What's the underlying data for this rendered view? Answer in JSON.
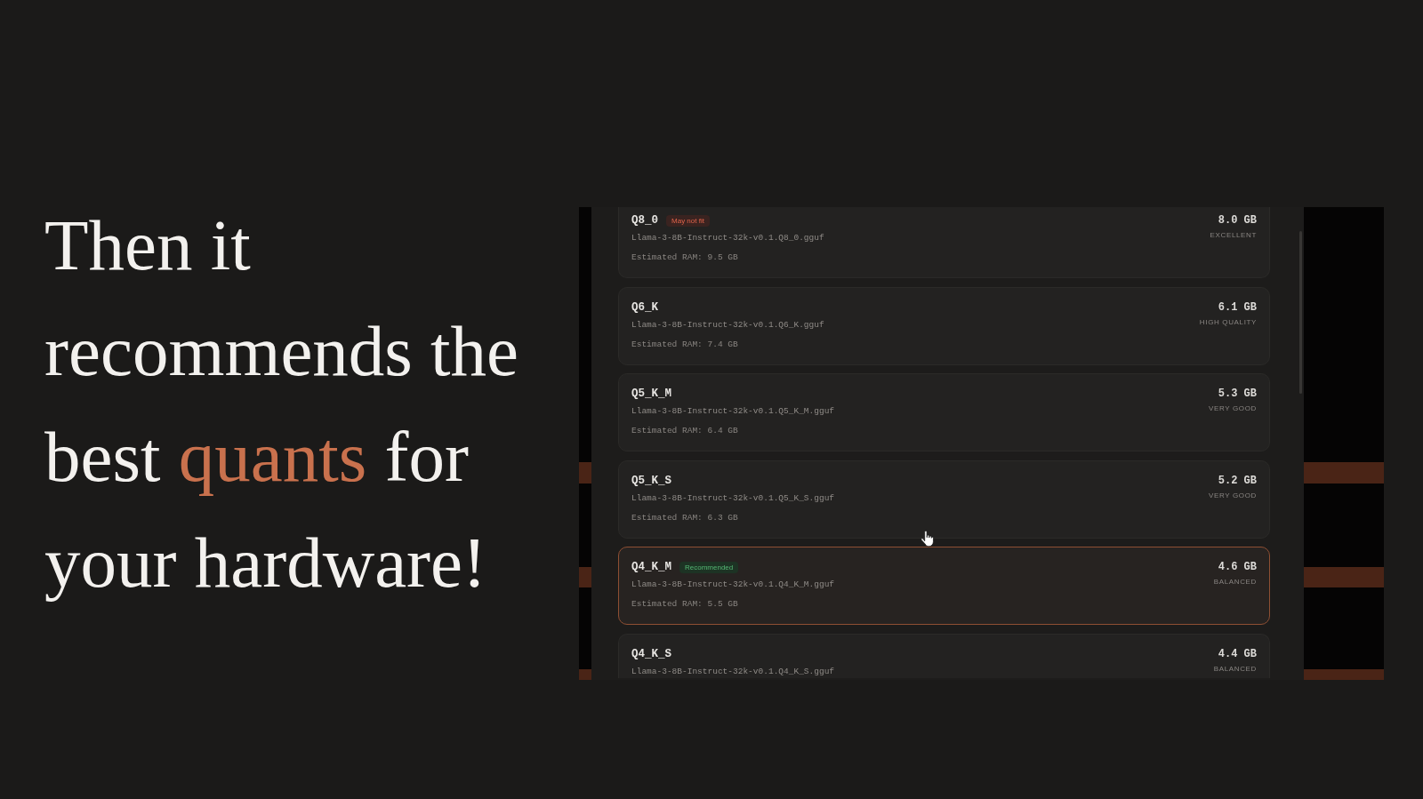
{
  "headline": {
    "lines": [
      [
        {
          "text": "Then it",
          "accent": false
        }
      ],
      [
        {
          "text": "recommends the",
          "accent": false
        }
      ],
      [
        {
          "text": "best ",
          "accent": false
        },
        {
          "text": "quants",
          "accent": true
        },
        {
          "text": " for",
          "accent": false
        }
      ],
      [
        {
          "text": "your hardware!",
          "accent": false
        }
      ]
    ]
  },
  "quant_list": {
    "items": [
      {
        "name": "Q8_0",
        "badge": {
          "kind": "warning",
          "label": "May not fit"
        },
        "file": "Llama-3-8B-Instruct-32k-v0.1.Q8_0.gguf",
        "ram": "Estimated RAM: 9.5 GB",
        "size": "8.0 GB",
        "quality": "EXCELLENT",
        "selected": false
      },
      {
        "name": "Q6_K",
        "file": "Llama-3-8B-Instruct-32k-v0.1.Q6_K.gguf",
        "ram": "Estimated RAM: 7.4 GB",
        "size": "6.1 GB",
        "quality": "HIGH QUALITY",
        "selected": false
      },
      {
        "name": "Q5_K_M",
        "file": "Llama-3-8B-Instruct-32k-v0.1.Q5_K_M.gguf",
        "ram": "Estimated RAM: 6.4 GB",
        "size": "5.3 GB",
        "quality": "VERY GOOD",
        "selected": false
      },
      {
        "name": "Q5_K_S",
        "file": "Llama-3-8B-Instruct-32k-v0.1.Q5_K_S.gguf",
        "ram": "Estimated RAM: 6.3 GB",
        "size": "5.2 GB",
        "quality": "VERY GOOD",
        "selected": false
      },
      {
        "name": "Q4_K_M",
        "badge": {
          "kind": "recommended",
          "label": "Recommended"
        },
        "file": "Llama-3-8B-Instruct-32k-v0.1.Q4_K_M.gguf",
        "ram": "Estimated RAM: 5.5 GB",
        "size": "4.6 GB",
        "quality": "BALANCED",
        "selected": true
      },
      {
        "name": "Q4_K_S",
        "file": "Llama-3-8B-Instruct-32k-v0.1.Q4_K_S.gguf",
        "size": "4.4 GB",
        "quality": "BALANCED",
        "selected": false
      }
    ]
  }
}
